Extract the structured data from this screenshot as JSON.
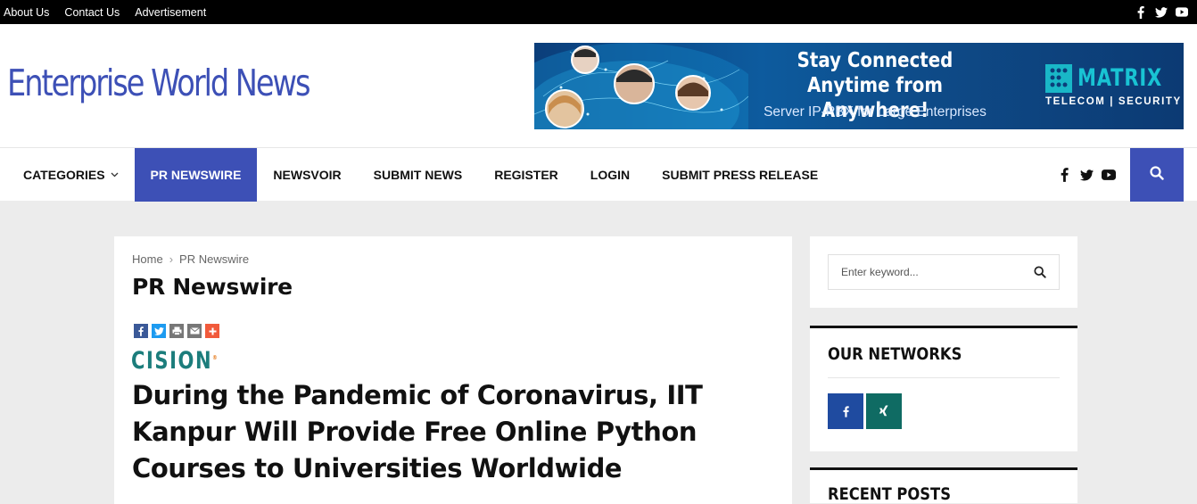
{
  "topbar": {
    "links": [
      "About Us",
      "Contact Us",
      "Advertisement"
    ],
    "social_icons": [
      "facebook-icon",
      "twitter-icon",
      "youtube-icon"
    ]
  },
  "header": {
    "logo": "Enterprise World News",
    "banner": {
      "headline_line1": "Stay Connected",
      "headline_line2": "Anytime from Anywhere!",
      "subline": "Server IP-PBX for Large Enterprises",
      "brand_name": "MATRIX",
      "brand_tagline": "TELECOM | SECURITY"
    }
  },
  "nav": {
    "items": [
      {
        "label": "CATEGORIES",
        "has_dropdown": true
      },
      {
        "label": "PR NEWSWIRE",
        "active": true
      },
      {
        "label": "NEWSVOIR"
      },
      {
        "label": "SUBMIT NEWS"
      },
      {
        "label": "REGISTER"
      },
      {
        "label": "LOGIN"
      },
      {
        "label": "SUBMIT PRESS RELEASE"
      }
    ],
    "social_icons": [
      "facebook-icon",
      "twitter-icon",
      "youtube-icon"
    ],
    "search_icon": "search-icon"
  },
  "main": {
    "breadcrumb": {
      "home": "Home",
      "separator": "›",
      "current": "PR Newswire"
    },
    "page_title": "PR Newswire",
    "share_icons": [
      "facebook-icon",
      "twitter-icon",
      "print-icon",
      "email-icon",
      "plus-icon"
    ],
    "source_logo": "CISION",
    "headline": "During the Pandemic of Coronavirus, IIT Kanpur Will Provide Free Online Python Courses to Universities Worldwide"
  },
  "sidebar": {
    "search_placeholder": "Enter keyword...",
    "networks_title": "OUR NETWORKS",
    "network_buttons": [
      "facebook-icon",
      "xing-icon"
    ],
    "recent_title": "RECENT POSTS"
  },
  "colors": {
    "accent": "#3d50b6",
    "topbar": "#000000",
    "facebook": "#1f4ba0",
    "xing": "#0f6b63",
    "cision": "#1c7d7c"
  }
}
